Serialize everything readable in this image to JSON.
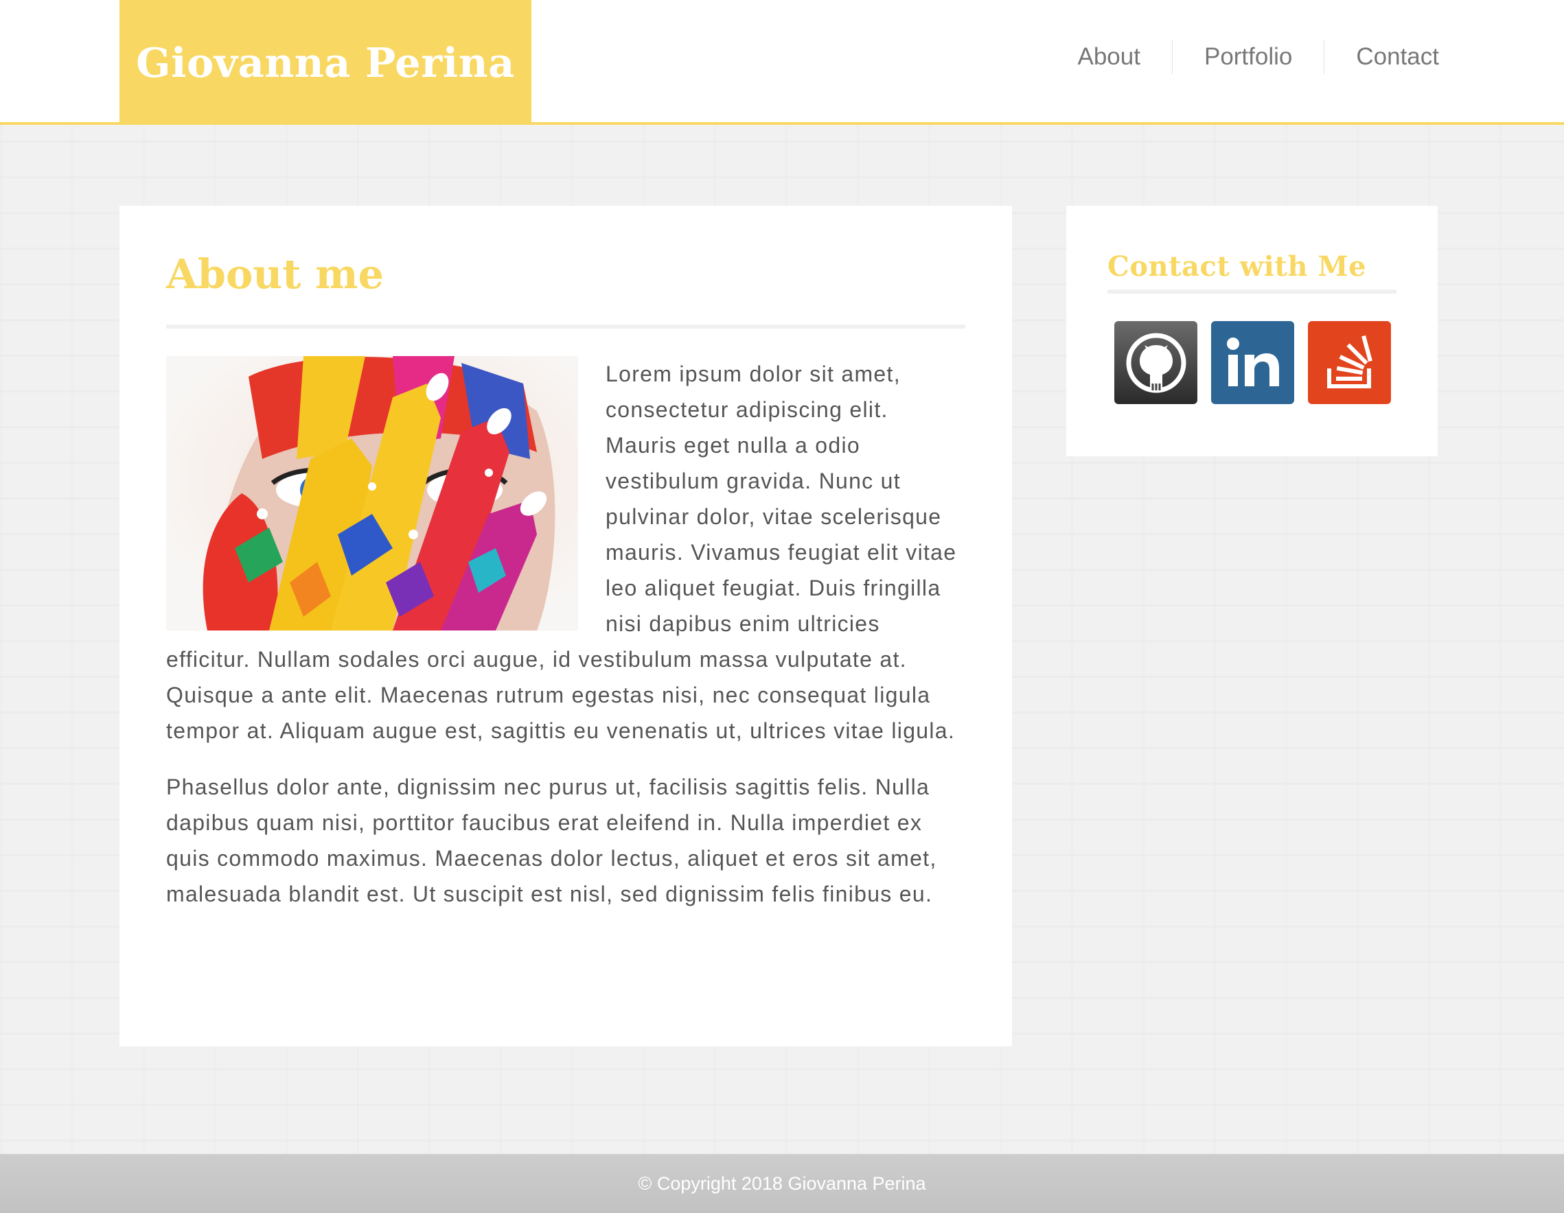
{
  "header": {
    "brand": "Giovanna Perina",
    "nav": [
      "About",
      "Portfolio",
      "Contact"
    ]
  },
  "main": {
    "title": "About me",
    "image_alt": "Face covered in colorful paint",
    "paragraphs": [
      "Lorem ipsum dolor sit amet, consectetur adipiscing elit. Mauris eget nulla a odio vestibulum gravida. Nunc ut pulvinar dolor, vitae scelerisque mauris. Vivamus feugiat elit vitae leo aliquet feugiat. Duis fringilla nisi dapibus enim ultricies efficitur. Nullam sodales orci augue, id vestibulum massa vulputate at. Quisque a ante elit. Maecenas rutrum egestas nisi, nec consequat ligula tempor at. Aliquam augue est, sagittis eu venenatis ut, ultrices vitae ligula.",
      "Phasellus dolor ante, dignissim nec purus ut, facilisis sagittis felis. Nulla dapibus quam nisi, porttitor faucibus erat eleifend in. Nulla imperdiet ex quis commodo maximus. Maecenas dolor lectus, aliquet et eros sit amet, malesuada blandit est. Ut suscipit est nisl, sed dignissim felis finibus eu."
    ]
  },
  "sidebar": {
    "title": "Contact with Me",
    "social": [
      {
        "icon": "github-icon",
        "color": "#333333"
      },
      {
        "icon": "linkedin-icon",
        "color": "#2d6594"
      },
      {
        "icon": "stackoverflow-icon",
        "color": "#e2451e"
      }
    ]
  },
  "footer": {
    "text": "© Copyright 2018 Giovanna Perina"
  },
  "colors": {
    "accent": "#f8d862",
    "text": "#555555",
    "nav_text": "#777777",
    "footer_bg": "#c8c8c8"
  }
}
